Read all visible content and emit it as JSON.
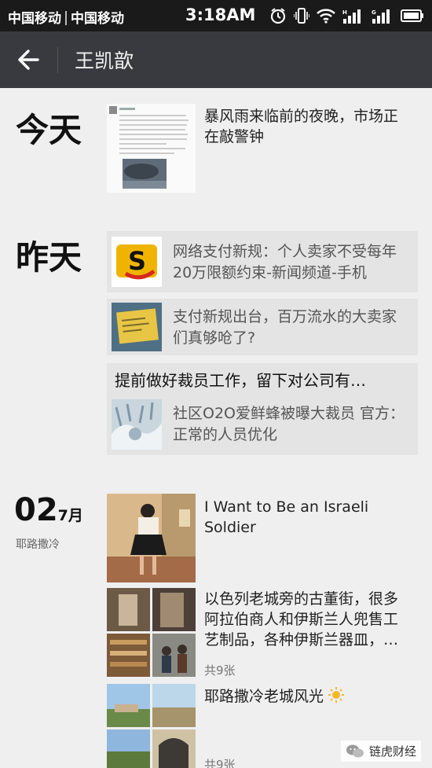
{
  "status": {
    "carrier1": "中国移动",
    "carrier2": "中国移动",
    "time": "3:18AM"
  },
  "header": {
    "title": "王凯歆"
  },
  "today": {
    "label": "今天",
    "post": {
      "text": "暴风雨来临前的夜晚，市场正在敲警钟"
    }
  },
  "yesterday": {
    "label": "昨天",
    "shares": [
      {
        "text": "网络支付新规：个人卖家不受每年20万限额约束-新闻频道-手机"
      },
      {
        "text": "支付新规出台，百万流水的大卖家们真够呛了?"
      }
    ],
    "share_with_comment": {
      "comment": "提前做好裁员工作，留下对公司有…",
      "text": "社区O2O爱鲜蜂被曝大裁员 官方：正常的人员优化"
    }
  },
  "july2": {
    "day": "02",
    "month": "7月",
    "location": "耶路撒冷",
    "posts": [
      {
        "text": "I Want to Be an Israeli Soldier"
      },
      {
        "text": "以色列老城旁的古董街，很多阿拉伯商人和伊斯兰人兜售工艺制品，各种伊斯兰器皿，…",
        "count": "共9张"
      },
      {
        "text": "耶路撒冷老城风光",
        "count": "共9张"
      }
    ]
  },
  "watermark": {
    "text": "链虎财经"
  }
}
